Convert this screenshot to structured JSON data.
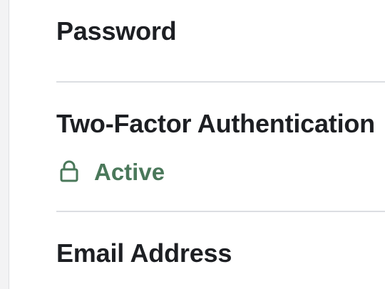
{
  "sections": {
    "password": {
      "heading": "Password"
    },
    "two_factor": {
      "heading": "Two-Factor Authentication",
      "status": {
        "label": "Active",
        "icon": "lock-icon",
        "color": "#4a785a"
      }
    },
    "email": {
      "heading": "Email Address"
    }
  }
}
